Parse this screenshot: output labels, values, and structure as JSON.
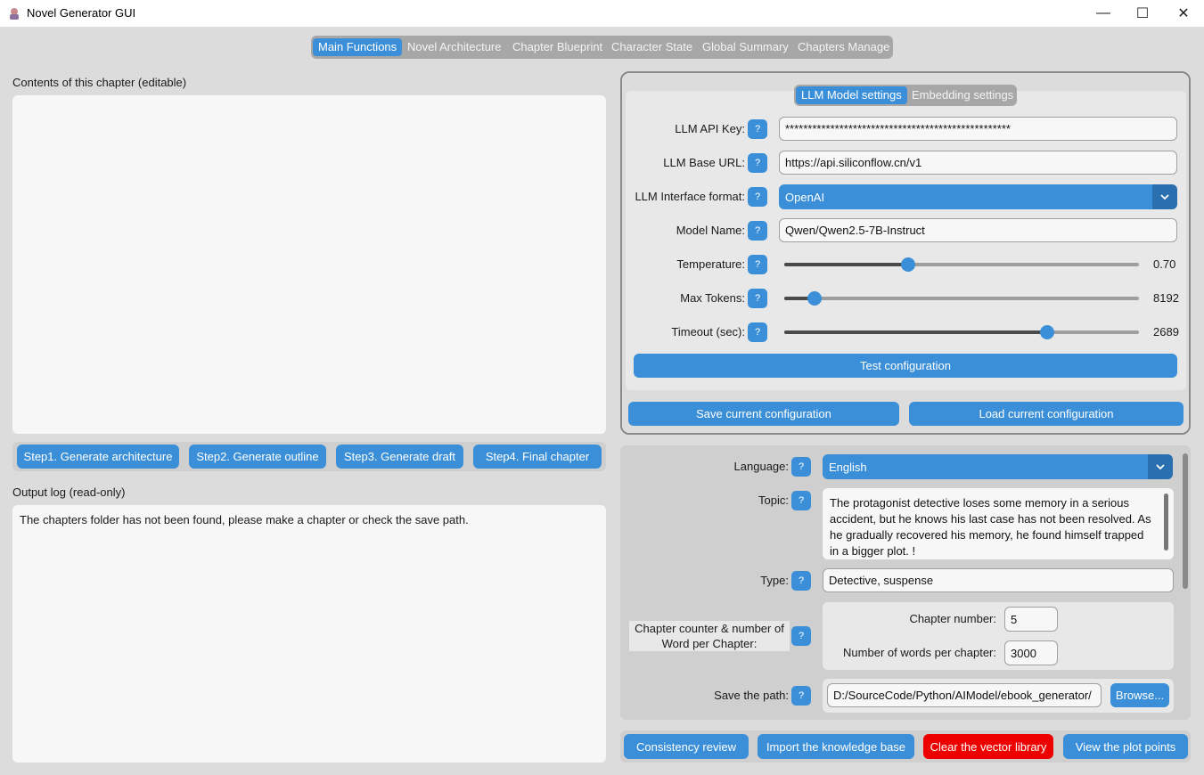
{
  "window": {
    "title": "Novel Generator GUI",
    "minimize": "—",
    "maximize": "☐",
    "close": "✕"
  },
  "tabs": [
    "Main Functions",
    "Novel Architecture",
    "Chapter Blueprint",
    "Character State",
    "Global Summary",
    "Chapters Manage"
  ],
  "left": {
    "chapter_label": "Contents of this chapter (editable)",
    "chapter_text": "",
    "steps": [
      "Step1. Generate architecture",
      "Step2. Generate outline",
      "Step3. Generate draft",
      "Step4. Final chapter"
    ],
    "log_label": "Output log (read-only)",
    "log_text": "The chapters folder has not been found, please make a chapter or check the save path."
  },
  "config": {
    "subtabs": [
      "LLM Model settings",
      "Embedding settings"
    ],
    "help": "?",
    "api_key_label": "LLM API Key:",
    "api_key_value": "**************************************************",
    "base_url_label": "LLM Base URL:",
    "base_url_value": "https://api.siliconflow.cn/v1",
    "interface_label": "LLM Interface format:",
    "interface_value": "OpenAI",
    "model_label": "Model Name:",
    "model_value": "Qwen/Qwen2.5-7B-Instruct",
    "temperature_label": "Temperature:",
    "temperature_value": "0.70",
    "temperature_level": 0.35,
    "max_tokens_label": "Max Tokens:",
    "max_tokens_value": "8192",
    "max_tokens_level": 0.085,
    "timeout_label": "Timeout (sec):",
    "timeout_value": "2689",
    "timeout_level": 0.74,
    "test_button": "Test configuration",
    "save_button": "Save current configuration",
    "load_button": "Load current configuration"
  },
  "params": {
    "language_label": "Language:",
    "language_value": "English",
    "topic_label": "Topic:",
    "topic_value": "The protagonist detective loses some memory in a serious accident, but he knows his last case has not been resolved. As he gradually recovered his memory, he found himself trapped in a bigger plot. !",
    "type_label": "Type:",
    "type_value": "Detective, suspense",
    "counter_label": "Chapter counter & number of Word per Chapter:",
    "chapter_number_label": "Chapter number:",
    "chapter_number_value": "5",
    "words_label": "Number of words per chapter:",
    "words_value": "3000",
    "save_path_label": "Save the path:",
    "save_path_value": "D:/SourceCode/Python/AIModel/ebook_generator/",
    "browse_button": "Browse..."
  },
  "actions": [
    "Consistency review",
    "Import the knowledge base",
    "Clear the vector library",
    "View the plot points"
  ],
  "colors": {
    "accent": "#3a8fd8",
    "danger": "#ee0000"
  }
}
